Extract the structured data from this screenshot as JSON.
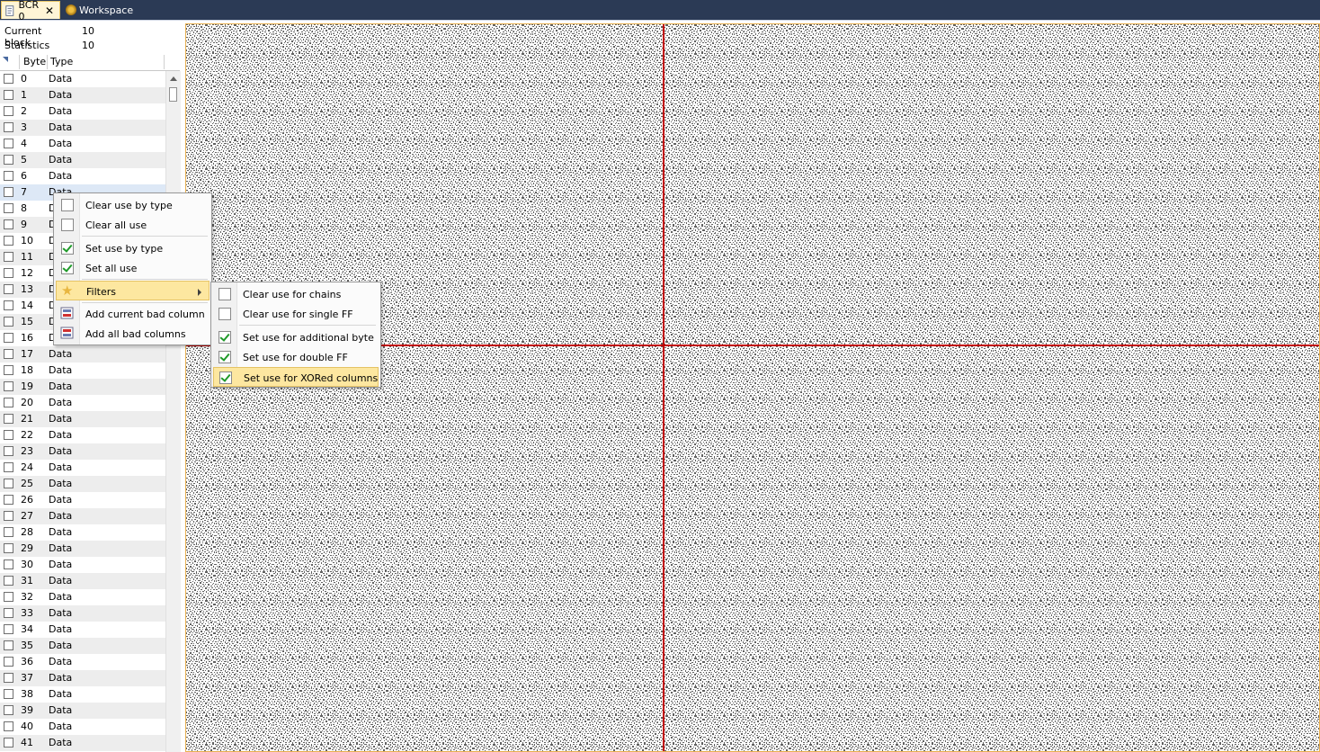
{
  "tabs": [
    {
      "label": "BCR 0",
      "icon": "document-icon",
      "active": true,
      "closable": true
    },
    {
      "label": "Workspace",
      "icon": "gear-icon",
      "active": false
    }
  ],
  "info": {
    "current_block_label": "Current block",
    "current_block_value": "10",
    "statistics_block_label": "Statistics block",
    "statistics_block_value": "10"
  },
  "grid": {
    "columns": [
      "Byte",
      "Type"
    ],
    "rows": [
      {
        "byte": "0",
        "type": "Data"
      },
      {
        "byte": "1",
        "type": "Data"
      },
      {
        "byte": "2",
        "type": "Data"
      },
      {
        "byte": "3",
        "type": "Data"
      },
      {
        "byte": "4",
        "type": "Data"
      },
      {
        "byte": "5",
        "type": "Data"
      },
      {
        "byte": "6",
        "type": "Data"
      },
      {
        "byte": "7",
        "type": "Data"
      },
      {
        "byte": "8",
        "type": "Data"
      },
      {
        "byte": "9",
        "type": "Data"
      },
      {
        "byte": "10",
        "type": "Data"
      },
      {
        "byte": "11",
        "type": "Data"
      },
      {
        "byte": "12",
        "type": "Data"
      },
      {
        "byte": "13",
        "type": "Data"
      },
      {
        "byte": "14",
        "type": "Data"
      },
      {
        "byte": "15",
        "type": "Data"
      },
      {
        "byte": "16",
        "type": "Data"
      },
      {
        "byte": "17",
        "type": "Data"
      },
      {
        "byte": "18",
        "type": "Data"
      },
      {
        "byte": "19",
        "type": "Data"
      },
      {
        "byte": "20",
        "type": "Data"
      },
      {
        "byte": "21",
        "type": "Data"
      },
      {
        "byte": "22",
        "type": "Data"
      },
      {
        "byte": "23",
        "type": "Data"
      },
      {
        "byte": "24",
        "type": "Data"
      },
      {
        "byte": "25",
        "type": "Data"
      },
      {
        "byte": "26",
        "type": "Data"
      },
      {
        "byte": "27",
        "type": "Data"
      },
      {
        "byte": "28",
        "type": "Data"
      },
      {
        "byte": "29",
        "type": "Data"
      },
      {
        "byte": "30",
        "type": "Data"
      },
      {
        "byte": "31",
        "type": "Data"
      },
      {
        "byte": "32",
        "type": "Data"
      },
      {
        "byte": "33",
        "type": "Data"
      },
      {
        "byte": "34",
        "type": "Data"
      },
      {
        "byte": "35",
        "type": "Data"
      },
      {
        "byte": "36",
        "type": "Data"
      },
      {
        "byte": "37",
        "type": "Data"
      },
      {
        "byte": "38",
        "type": "Data"
      },
      {
        "byte": "39",
        "type": "Data"
      },
      {
        "byte": "40",
        "type": "Data"
      },
      {
        "byte": "41",
        "type": "Data"
      }
    ],
    "selected_byte": "7"
  },
  "context_menu": {
    "items": {
      "clear_use_by_type": "Clear use by type",
      "clear_all_use": "Clear all use",
      "set_use_by_type": "Set use by type",
      "set_all_use": "Set all use",
      "filters": "Filters",
      "add_current_bad_column": "Add current bad column",
      "add_all_bad_columns": "Add all bad columns"
    }
  },
  "filters_submenu": {
    "items": {
      "clear_use_for_chains": "Clear use for chains",
      "clear_use_for_single_ff": "Clear use for single FF",
      "set_use_for_additional_byte": "Set use for additional byte",
      "set_use_for_double_ff": "Set use for double FF",
      "set_use_for_xored_columns": "Set use for XORed columns"
    },
    "highlighted": "Set use for XORed columns"
  },
  "colors": {
    "tabbar": "#2b3a55",
    "crosshair": "#c00000",
    "bitmap_dark": "#606060",
    "menu_highlight": "#fde7a0",
    "check_green": "#1f9a2a"
  }
}
